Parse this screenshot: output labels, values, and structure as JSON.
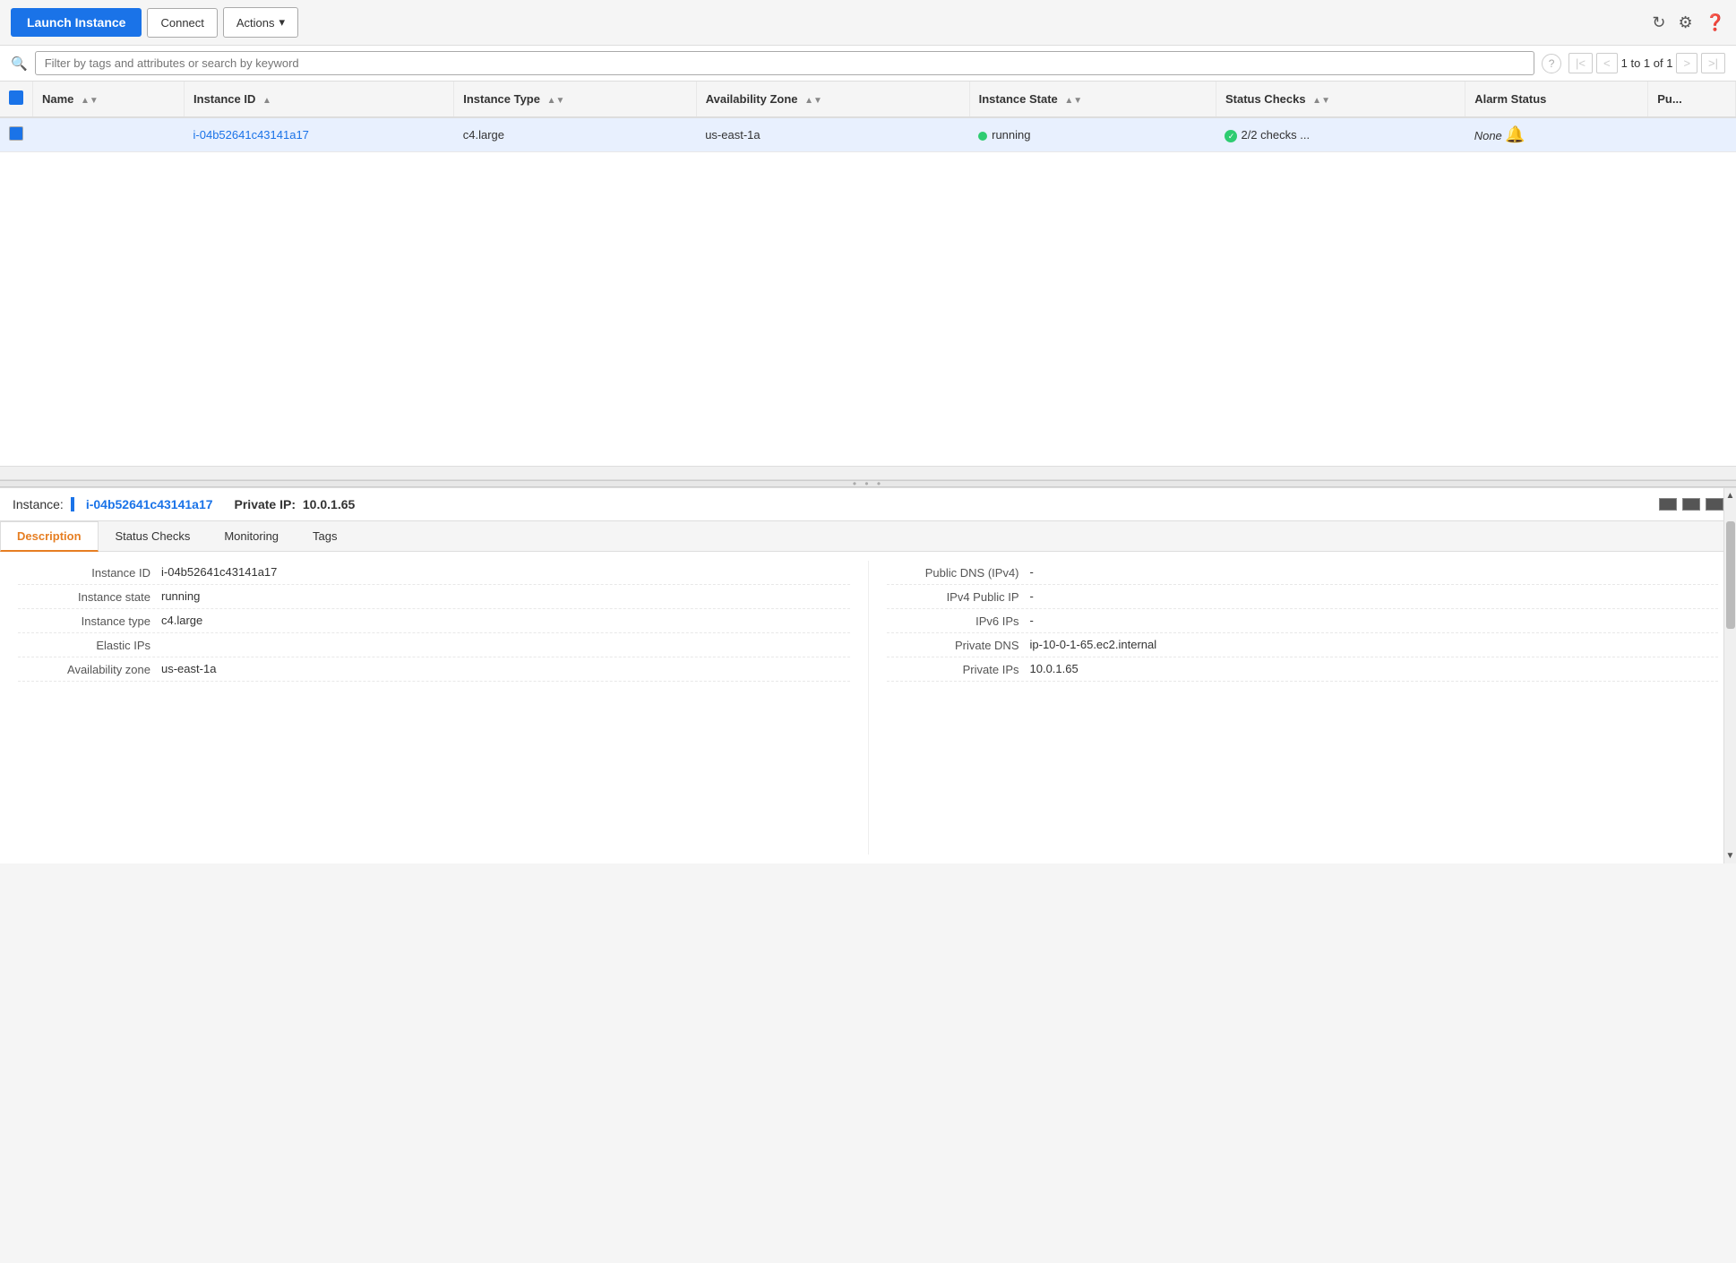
{
  "toolbar": {
    "launch_label": "Launch Instance",
    "connect_label": "Connect",
    "actions_label": "Actions"
  },
  "search": {
    "placeholder": "Filter by tags and attributes or search by keyword"
  },
  "pagination": {
    "text": "1 to 1 of 1",
    "first_label": "|<",
    "prev_label": "<",
    "next_label": ">",
    "last_label": ">|"
  },
  "table": {
    "columns": [
      {
        "key": "name",
        "label": "Name",
        "sortable": true
      },
      {
        "key": "instance_id",
        "label": "Instance ID",
        "sortable": true,
        "sorted": "asc"
      },
      {
        "key": "instance_type",
        "label": "Instance Type",
        "sortable": true
      },
      {
        "key": "availability_zone",
        "label": "Availability Zone",
        "sortable": true
      },
      {
        "key": "instance_state",
        "label": "Instance State",
        "sortable": true
      },
      {
        "key": "status_checks",
        "label": "Status Checks",
        "sortable": true
      },
      {
        "key": "alarm_status",
        "label": "Alarm Status",
        "sortable": false
      },
      {
        "key": "public",
        "label": "Pu...",
        "sortable": false
      }
    ],
    "rows": [
      {
        "selected": true,
        "name": "",
        "instance_id": "i-04b52641c43141a17",
        "instance_type": "c4.large",
        "availability_zone": "us-east-1a",
        "instance_state": "running",
        "status_checks": "2/2 checks ...",
        "alarm_status": "None",
        "public": ""
      }
    ]
  },
  "detail": {
    "instance_label": "Instance:",
    "instance_id": "i-04b52641c43141a17",
    "private_ip_label": "Private IP:",
    "private_ip": "10.0.1.65",
    "tabs": [
      "Description",
      "Status Checks",
      "Monitoring",
      "Tags"
    ],
    "active_tab": "Description",
    "left_fields": [
      {
        "label": "Instance ID",
        "value": "i-04b52641c43141a17",
        "type": "normal"
      },
      {
        "label": "Instance state",
        "value": "running",
        "type": "normal"
      },
      {
        "label": "Instance type",
        "value": "c4.large",
        "type": "normal"
      },
      {
        "label": "Elastic IPs",
        "value": "",
        "type": "normal"
      },
      {
        "label": "Availability zone",
        "value": "us-east-1a",
        "type": "normal"
      }
    ],
    "right_fields": [
      {
        "label": "Public DNS (IPv4)",
        "value": "-",
        "type": "normal"
      },
      {
        "label": "IPv4 Public IP",
        "value": "-",
        "type": "normal"
      },
      {
        "label": "IPv6 IPs",
        "value": "-",
        "type": "normal"
      },
      {
        "label": "Private DNS",
        "value": "ip-10-0-1-65.ec2.internal",
        "type": "normal"
      },
      {
        "label": "Private IPs",
        "value": "10.0.1.65",
        "type": "normal"
      }
    ]
  }
}
